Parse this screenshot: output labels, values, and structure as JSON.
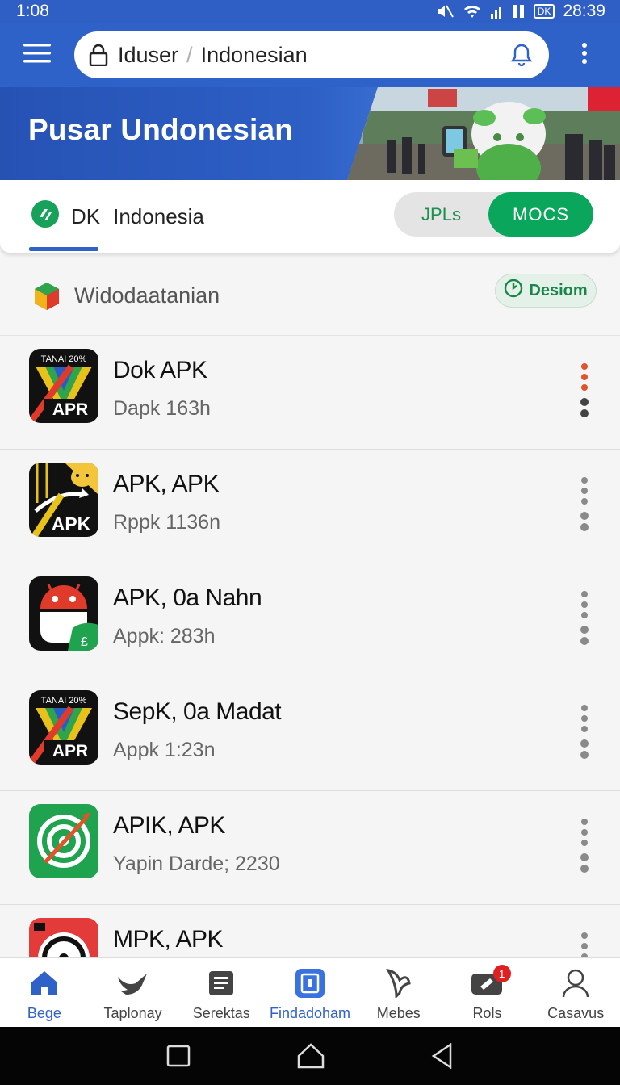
{
  "status_bar": {
    "time": "1:08",
    "clock_right": "28:39",
    "icons": [
      "mute-icon",
      "wifi-icon",
      "signal-icon",
      "battery-icon"
    ],
    "battery_label": "DK"
  },
  "app_bar": {
    "url_left": "Iduser",
    "url_separator": "/",
    "url_right": "Indonesian",
    "icons": [
      "menu-icon",
      "lock-icon",
      "bell-icon",
      "more-vert-icon"
    ]
  },
  "banner": {
    "title": "Pusar Undonesian"
  },
  "region": {
    "code": "DK",
    "name": "Indonesia",
    "seg_left": "JPLs",
    "seg_right": "MOCS",
    "accent": "#0aa65b"
  },
  "section": {
    "title": "Widodaatanian",
    "button_label": "Desiom"
  },
  "apps": [
    {
      "name": "Dok APK",
      "sub": "Dapk 163h",
      "icon": "apr-icon",
      "icon_text": "APR",
      "icon_top": "TANAI 20%"
    },
    {
      "name": "APK, APK",
      "sub": "Rppk 1136n",
      "icon": "apk-icon",
      "icon_text": "APK"
    },
    {
      "name": "APK, 0a Nahn",
      "sub": "Appk: 283h",
      "icon": "android-robot-icon"
    },
    {
      "name": "SepK, 0a Madat",
      "sub": "Appk 1:23n",
      "icon": "apr-icon",
      "icon_text": "APR",
      "icon_top": "TANAI 20%"
    },
    {
      "name": "APIK, APK",
      "sub": "Yapin Darde; 2230",
      "icon": "target-icon"
    },
    {
      "name": "MPK, APK",
      "sub": "",
      "icon": "clock-icon"
    }
  ],
  "bottom_nav": [
    {
      "label": "Bege",
      "icon": "home-icon",
      "active": true
    },
    {
      "label": "Taplonay",
      "icon": "bird-icon",
      "active": false
    },
    {
      "label": "Serektas",
      "icon": "list-icon",
      "active": false
    },
    {
      "label": "Findadoham",
      "icon": "download-box-icon",
      "active": true
    },
    {
      "label": "Mebes",
      "icon": "leaf-icon",
      "active": false
    },
    {
      "label": "Rols",
      "icon": "ticket-icon",
      "active": false,
      "badge": "1"
    },
    {
      "label": "Casavus",
      "icon": "person-icon",
      "active": false
    }
  ],
  "colors": {
    "primary": "#2f62c8",
    "green": "#0aa65b",
    "badge_red": "#e02020"
  }
}
